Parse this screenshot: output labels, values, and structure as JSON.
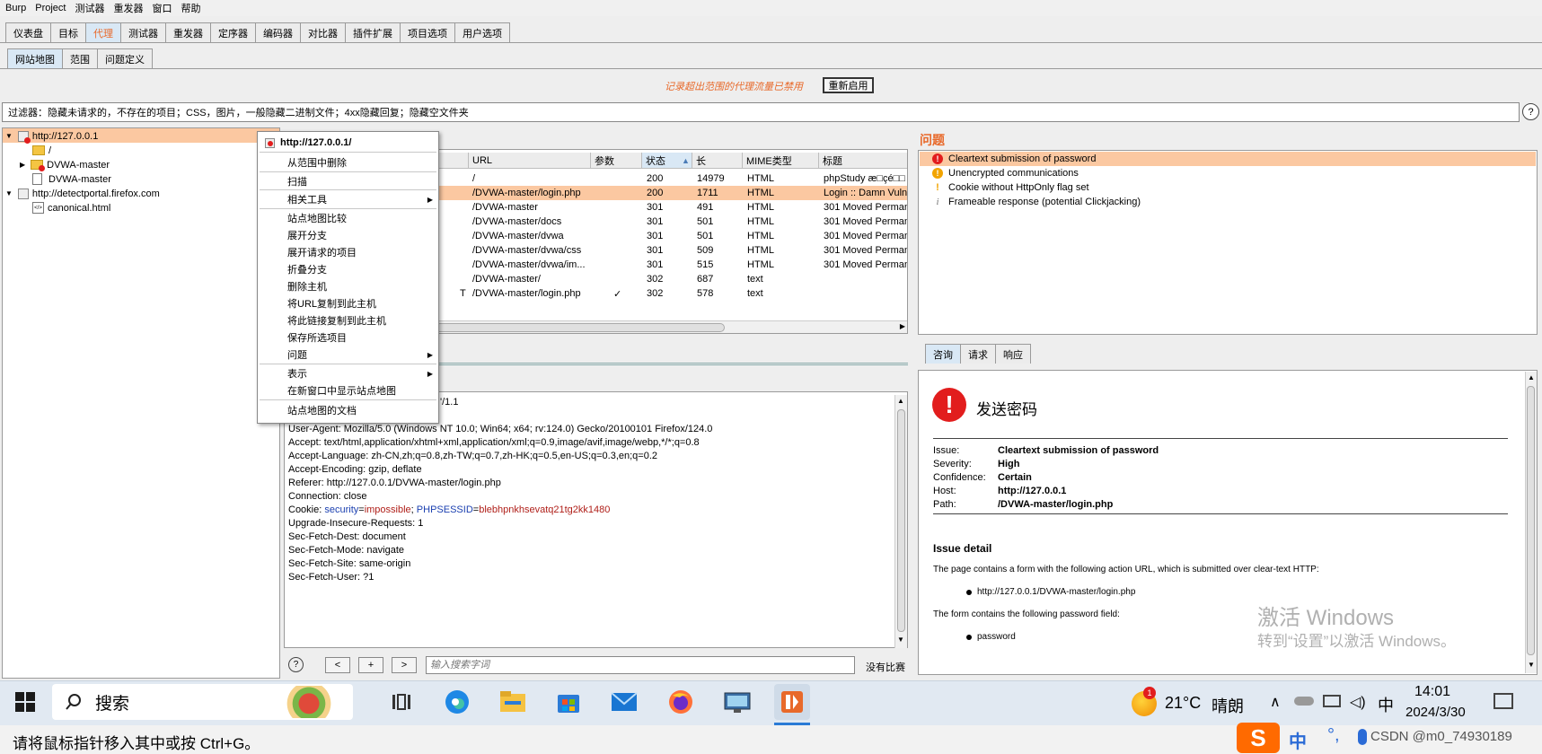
{
  "menu": [
    "Burp",
    "Project",
    "测试器",
    "重发器",
    "窗口",
    "帮助"
  ],
  "main_tabs": [
    "仪表盘",
    "目标",
    "代理",
    "测试器",
    "重发器",
    "定序器",
    "编码器",
    "对比器",
    "插件扩展",
    "项目选项",
    "用户选项"
  ],
  "sub_tabs": [
    "网站地图",
    "范围",
    "问题定义"
  ],
  "scope_notice": "记录超出范围的代理流量已禁用",
  "reenable_label": "重新启用",
  "filter_text": "过滤器：隐藏未请求的，不存在的项目；CSS，图片，一般隐藏二进制文件；4xx隐藏回复；隐藏空文件夹",
  "help_symbol": "?",
  "tree": {
    "host1": "http://127.0.0.1",
    "slash": "/",
    "dvwa1": "DVWA-master",
    "dvwa2": "DVWA-master",
    "host2": "http://detectportal.firefox.com",
    "canonical": "canonical.html"
  },
  "context_menu": {
    "header": "http://127.0.0.1/",
    "items": [
      "从范围中删除",
      "扫描",
      "相关工具",
      "站点地图比较",
      "展开分支",
      "展开请求的项目",
      "折叠分支",
      "删除主机",
      "将URL复制到此主机",
      "将此链接复制到此主机",
      "保存所选项目",
      "问题",
      "表示",
      "在新窗口中显示站点地图",
      "站点地图的文档"
    ]
  },
  "table": {
    "headers": [
      "URL",
      "参数",
      "状态",
      "长",
      "MIME类型",
      "标题"
    ],
    "sort_indicator": "▲",
    "rows": [
      {
        "method": "",
        "url": "/",
        "param": "",
        "status": "200",
        "length": "14979",
        "mime": "HTML",
        "title": "phpStudy æ□çé□□"
      },
      {
        "method": "",
        "url": "/DVWA-master/login.php",
        "param": "",
        "status": "200",
        "length": "1711",
        "mime": "HTML",
        "title": "Login :: Damn Vulne"
      },
      {
        "method": "",
        "url": "/DVWA-master",
        "param": "",
        "status": "301",
        "length": "491",
        "mime": "HTML",
        "title": "301 Moved Perman"
      },
      {
        "method": "",
        "url": "/DVWA-master/docs",
        "param": "",
        "status": "301",
        "length": "501",
        "mime": "HTML",
        "title": "301 Moved Perman"
      },
      {
        "method": "",
        "url": "/DVWA-master/dvwa",
        "param": "",
        "status": "301",
        "length": "501",
        "mime": "HTML",
        "title": "301 Moved Perman"
      },
      {
        "method": "",
        "url": "/DVWA-master/dvwa/css",
        "param": "",
        "status": "301",
        "length": "509",
        "mime": "HTML",
        "title": "301 Moved Perman"
      },
      {
        "method": "",
        "url": "/DVWA-master/dvwa/im...",
        "param": "",
        "status": "301",
        "length": "515",
        "mime": "HTML",
        "title": "301 Moved Perman"
      },
      {
        "method": "",
        "url": "/DVWA-master/",
        "param": "",
        "status": "302",
        "length": "687",
        "mime": "text",
        "title": ""
      },
      {
        "method": "T",
        "url": "/DVWA-master/login.php",
        "param": "✓",
        "status": "302",
        "length": "578",
        "mime": "text",
        "title": ""
      }
    ]
  },
  "request": {
    "first_line_tail": "'/1.1",
    "lines": [
      "User-Agent: Mozilla/5.0 (Windows NT 10.0; Win64; x64; rv:124.0) Gecko/20100101 Firefox/124.0",
      "Accept: text/html,application/xhtml+xml,application/xml;q=0.9,image/avif,image/webp,*/*;q=0.8",
      "Accept-Language: zh-CN,zh;q=0.8,zh-TW;q=0.7,zh-HK;q=0.5,en-US;q=0.3,en;q=0.2",
      "Accept-Encoding: gzip, deflate",
      "Referer: http://127.0.0.1/DVWA-master/login.php",
      "Connection: close"
    ],
    "cookie_prefix": "Cookie: ",
    "cookie_k1": "security",
    "cookie_v1": "impossible",
    "cookie_sep": "; ",
    "cookie_k2": "PHPSESSID",
    "cookie_v2": "blebhpnkhsevatq21tg2kk1480",
    "eq": "=",
    "lines2": [
      "Upgrade-Insecure-Requests: 1",
      "Sec-Fetch-Dest: document",
      "Sec-Fetch-Mode: navigate",
      "Sec-Fetch-Site: same-origin",
      "Sec-Fetch-User: ?1"
    ],
    "search_placeholder": "输入搜索字词",
    "match_text": "没有比赛",
    "nav_prev": "<",
    "nav_add": "+",
    "nav_next": ">"
  },
  "issues": {
    "title": "问题",
    "items": [
      {
        "label": "Cleartext submission of password",
        "severity": "high"
      },
      {
        "label": "Unencrypted communications",
        "severity": "medium"
      },
      {
        "label": "Cookie without HttpOnly flag set",
        "severity": "low"
      },
      {
        "label": "Frameable response (potential Clickjacking)",
        "severity": "info"
      }
    ]
  },
  "detail_tabs": [
    "咨询",
    "请求",
    "响应"
  ],
  "advisory": {
    "heading": "发送密码",
    "fields": [
      {
        "k": "Issue:",
        "v": "Cleartext submission of password"
      },
      {
        "k": "Severity:",
        "v": "High"
      },
      {
        "k": "Confidence:",
        "v": "Certain"
      },
      {
        "k": "Host:",
        "v": "http://127.0.0.1"
      },
      {
        "k": "Path:",
        "v": "/DVWA-master/login.php"
      }
    ],
    "detail_title": "Issue detail",
    "p1": "The page contains a form with the following action URL, which is submitted over clear-text HTTP:",
    "b1": "http://127.0.0.1/DVWA-master/login.php",
    "p2": "The form contains the following password field:",
    "b2": "password"
  },
  "watermark": {
    "line1": "激活 Windows",
    "line2": "转到“设置”以激活 Windows。"
  },
  "taskbar": {
    "search": "搜索",
    "weather_temp": "21°C",
    "weather_desc": "晴朗",
    "ime": "中",
    "time": "14:01",
    "date": "2024/3/30",
    "badge": "1"
  },
  "status_bar": {
    "hint": "请将鼠标指针移入其中或按 Ctrl+G。",
    "ime_char": "中",
    "csdn": "CSDN @m0_74930189"
  },
  "colors": {
    "accent": "#e8692a",
    "selection": "#fbc8a1",
    "tab_blue": "#d9e8f5",
    "high": "#e21d1d",
    "medium": "#f2a400",
    "taskbar": "#e1e9f2"
  }
}
